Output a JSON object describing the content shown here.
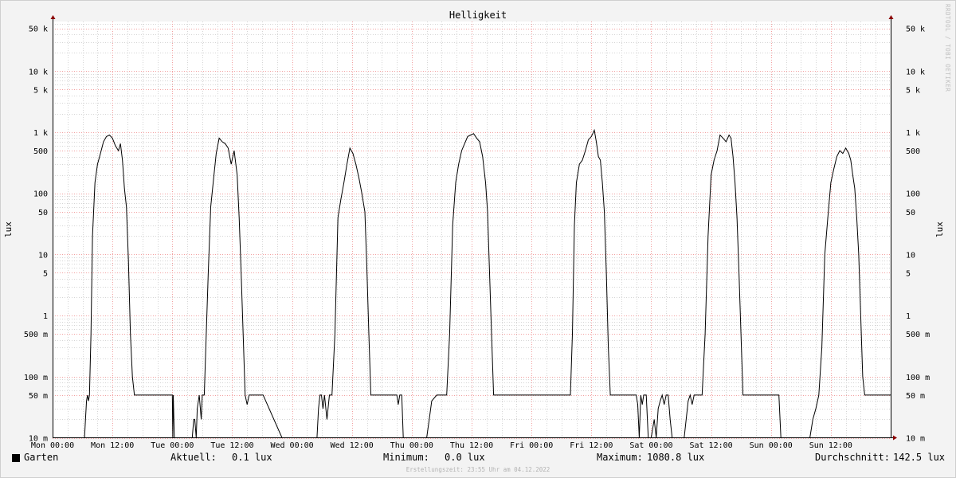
{
  "watermark": "RRDTOOL / TOBI OETIKER",
  "footer": "Erstellungszeit: 23:55 Uhr am 04.12.2022",
  "legend": {
    "series_name": "Garten",
    "current_label": "Aktuell:",
    "current_value": "0.1 lux",
    "min_label": "Minimum:",
    "min_value": "0.0 lux",
    "max_label": "Maximum:",
    "max_value": "1080.8 lux",
    "avg_label": "Durchschnitt:",
    "avg_value": "142.5 lux"
  },
  "colors": {
    "line": "#000000",
    "major_grid": "#f2a0a0",
    "minor_grid": "#d5d5d5",
    "plot_bg": "#ffffff",
    "page_bg": "#f3f3f3",
    "axis": "#000000",
    "arrow": "#8b0000"
  },
  "chart_data": {
    "type": "line",
    "title": "Helligkeit",
    "ylabel": "lux",
    "y_scale": "log",
    "ylim": [
      0.01,
      80000
    ],
    "xlim_hours": [
      0,
      168
    ],
    "x_ticks": [
      {
        "hour": 0,
        "label": "Mon 00:00"
      },
      {
        "hour": 12,
        "label": "Mon 12:00"
      },
      {
        "hour": 24,
        "label": "Tue 00:00"
      },
      {
        "hour": 36,
        "label": "Tue 12:00"
      },
      {
        "hour": 48,
        "label": "Wed 00:00"
      },
      {
        "hour": 60,
        "label": "Wed 12:00"
      },
      {
        "hour": 72,
        "label": "Thu 00:00"
      },
      {
        "hour": 84,
        "label": "Thu 12:00"
      },
      {
        "hour": 96,
        "label": "Fri 00:00"
      },
      {
        "hour": 108,
        "label": "Fri 12:00"
      },
      {
        "hour": 120,
        "label": "Sat 00:00"
      },
      {
        "hour": 132,
        "label": "Sat 12:00"
      },
      {
        "hour": 144,
        "label": "Sun 00:00"
      },
      {
        "hour": 156,
        "label": "Sun 12:00"
      }
    ],
    "y_ticks": [
      {
        "value": 0.01,
        "label": "10 m"
      },
      {
        "value": 0.05,
        "label": "50 m"
      },
      {
        "value": 0.1,
        "label": "100 m"
      },
      {
        "value": 0.5,
        "label": "500 m"
      },
      {
        "value": 1,
        "label": "1"
      },
      {
        "value": 5,
        "label": "5"
      },
      {
        "value": 10,
        "label": "10"
      },
      {
        "value": 50,
        "label": "50"
      },
      {
        "value": 100,
        "label": "100"
      },
      {
        "value": 500,
        "label": "500"
      },
      {
        "value": 1000,
        "label": "1 k"
      },
      {
        "value": 5000,
        "label": "5 k"
      },
      {
        "value": 10000,
        "label": "10 k"
      },
      {
        "value": 50000,
        "label": "50 k"
      }
    ],
    "series": [
      {
        "name": "Garten",
        "x_hours": [
          0,
          6.4,
          6.6,
          6.8,
          7.0,
          7.2,
          7.4,
          7.7,
          8.0,
          8.5,
          9.0,
          9.6,
          10.2,
          10.8,
          11.4,
          12.0,
          12.6,
          13.2,
          13.6,
          14.0,
          14.4,
          14.8,
          15.2,
          15.6,
          16.0,
          16.4,
          16.8,
          17.2,
          17.6,
          18.0,
          24.0,
          24.1,
          24.2,
          24.4,
          28.0,
          28.3,
          28.5,
          28.8,
          29.0,
          29.4,
          29.8,
          30.0,
          30.4,
          30.8,
          31.2,
          31.7,
          32.2,
          32.8,
          33.4,
          34.0,
          34.6,
          35.2,
          35.8,
          36.4,
          37.0,
          37.4,
          37.8,
          38.2,
          38.6,
          39.0,
          39.4,
          39.8,
          40.2,
          40.6,
          41.0,
          41.4,
          41.8,
          42.2,
          46.0,
          46.4,
          46.8,
          47.2,
          48.0,
          53.0,
          53.3,
          53.6,
          53.9,
          54.2,
          54.5,
          55.0,
          55.5,
          56.0,
          56.6,
          57.2,
          57.8,
          58.4,
          59.0,
          59.6,
          60.2,
          60.8,
          61.4,
          62.0,
          62.6,
          63.0,
          63.4,
          63.8,
          64.2,
          64.6,
          65.0,
          65.4,
          69.0,
          69.3,
          69.6,
          70.0,
          70.3,
          70.6,
          71.0,
          72.0,
          75.0,
          75.5,
          76.0,
          77.0,
          78.0,
          78.4,
          79.0,
          79.6,
          80.2,
          80.8,
          81.4,
          82.0,
          82.6,
          83.2,
          83.8,
          84.4,
          85.0,
          85.6,
          86.2,
          86.8,
          87.2,
          87.6,
          88.0,
          88.4,
          88.8,
          89.2,
          89.6,
          96.0,
          103.0,
          103.4,
          103.8,
          104.2,
          104.6,
          105.0,
          105.6,
          106.2,
          106.8,
          107.4,
          108.0,
          108.6,
          109.0,
          109.4,
          109.8,
          110.2,
          110.6,
          111.0,
          111.4,
          111.8,
          112.2,
          112.6,
          113.0,
          113.4,
          113.8,
          114.2,
          114.6,
          117.0,
          117.3,
          117.6,
          117.9,
          118.2,
          118.5,
          119.0,
          119.4,
          119.8,
          120.0,
          120.6,
          121.0,
          121.4,
          121.8,
          122.2,
          122.6,
          123.0,
          123.4,
          123.8,
          124.2,
          124.6,
          125.0,
          125.4,
          125.8,
          126.2,
          126.6,
          127.0,
          127.4,
          127.8,
          128.2,
          128.6,
          129.0,
          129.6,
          130.2,
          130.8,
          131.4,
          132.0,
          132.6,
          133.2,
          133.8,
          134.4,
          135.0,
          135.6,
          136.0,
          136.4,
          136.8,
          137.2,
          137.6,
          138.0,
          138.4,
          138.8,
          139.2,
          144.0,
          144.4,
          144.8,
          145.2,
          145.6,
          146.0,
          146.4,
          146.8,
          147.2,
          147.6,
          148.0,
          148.4,
          148.8,
          149.2,
          149.6,
          150.0,
          150.6,
          151.2,
          151.8,
          152.4,
          153.0,
          153.6,
          154.2,
          154.8,
          155.4,
          156.0,
          156.6,
          157.2,
          157.8,
          158.4,
          159.0,
          159.6,
          160.0,
          160.4,
          160.8,
          161.2,
          161.6,
          162.0,
          162.4,
          162.8,
          168.0
        ],
        "values": [
          0.01,
          0.01,
          0.02,
          0.04,
          0.05,
          0.04,
          0.05,
          0.5,
          20,
          150,
          300,
          450,
          700,
          850,
          900,
          800,
          600,
          500,
          650,
          350,
          120,
          60,
          8,
          0.5,
          0.1,
          0.05,
          0.05,
          0.05,
          0.05,
          0.05,
          0.05,
          0.01,
          0.05,
          0.01,
          0.01,
          0.02,
          0.02,
          0.01,
          0.03,
          0.05,
          0.02,
          0.05,
          0.05,
          0.5,
          5,
          60,
          150,
          450,
          800,
          700,
          650,
          550,
          300,
          500,
          200,
          40,
          5,
          0.5,
          0.05,
          0.035,
          0.05,
          0.05,
          0.05,
          0.05,
          0.05,
          0.05,
          0.05,
          0.05,
          0.01,
          0.01,
          0.01,
          0.01,
          0.01,
          0.01,
          0.03,
          0.05,
          0.05,
          0.03,
          0.05,
          0.02,
          0.05,
          0.05,
          0.5,
          40,
          80,
          150,
          300,
          550,
          450,
          300,
          180,
          100,
          50,
          6,
          0.5,
          0.05,
          0.05,
          0.05,
          0.05,
          0.05,
          0.05,
          0.035,
          0.05,
          0.05,
          0.01,
          0.01,
          0.01,
          0.01,
          0.01,
          0.02,
          0.04,
          0.05,
          0.05,
          0.05,
          0.05,
          0.5,
          30,
          150,
          300,
          500,
          650,
          850,
          900,
          950,
          800,
          700,
          400,
          150,
          50,
          5,
          0.5,
          0.05,
          0.05,
          0.05,
          0.05,
          0.05,
          0.05,
          0.05,
          0.05,
          0.5,
          30,
          150,
          300,
          350,
          500,
          750,
          850,
          1080,
          700,
          400,
          350,
          150,
          50,
          5,
          0.3,
          0.05,
          0.05,
          0.05,
          0.05,
          0.05,
          0.05,
          0.05,
          0.05,
          0.05,
          0.035,
          0.01,
          0.05,
          0.035,
          0.05,
          0.05,
          0.01,
          0.01,
          0.01,
          0.02,
          0.01,
          0.03,
          0.04,
          0.05,
          0.035,
          0.05,
          0.05,
          0.02,
          0.01,
          0.01,
          0.01,
          0.01,
          0.01,
          0.01,
          0.01,
          0.02,
          0.04,
          0.05,
          0.035,
          0.05,
          0.05,
          0.05,
          0.05,
          0.5,
          20,
          200,
          350,
          500,
          900,
          800,
          700,
          900,
          800,
          400,
          150,
          40,
          5,
          0.5,
          0.05,
          0.05,
          0.05,
          0.05,
          0.05,
          0.05,
          0.05,
          0.05,
          0.01,
          0.01,
          0.01,
          0.01,
          0.01,
          0.01,
          0.01,
          0.01,
          0.01,
          0.01,
          0.01,
          0.01,
          0.01,
          0.01,
          0.02,
          0.03,
          0.05,
          0.3,
          10,
          40,
          150,
          250,
          400,
          500,
          450,
          550,
          450,
          350,
          200,
          120,
          40,
          10,
          1,
          0.1,
          0.05,
          0.05,
          0.05,
          0.05,
          0.05,
          0.05,
          0.05,
          0.05,
          0.05
        ]
      }
    ]
  }
}
